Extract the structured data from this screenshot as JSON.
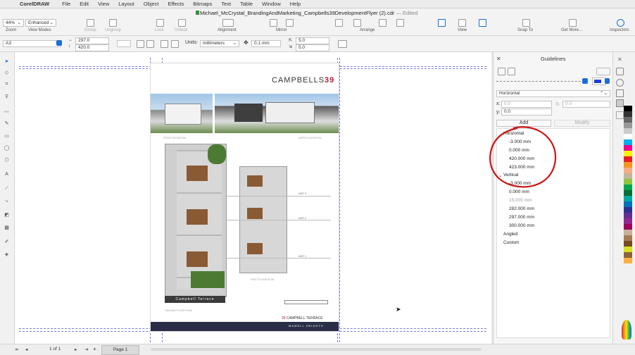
{
  "menubar": {
    "app": "CorelDRAW",
    "items": [
      "File",
      "Edit",
      "View",
      "Layout",
      "Object",
      "Effects",
      "Bitmaps",
      "Text",
      "Table",
      "Window",
      "Help"
    ]
  },
  "toolbar": {
    "title": "Michael_McCrystal_BrandingAndMarketing_Campbells39DevelopmentFlyer (2).cdr",
    "edited": "— Edited",
    "zoom_value": "44%",
    "view_mode_value": "Enhanced",
    "labels": {
      "zoom": "Zoom",
      "view_modes": "View Modes",
      "group": "Group",
      "ungroup": "Ungroup",
      "lock": "Lock",
      "unlock": "Unlock",
      "alignment": "Alignment",
      "mirror": "Mirror",
      "arrange": "Arrange",
      "view": "View",
      "snap_to": "Snap To",
      "get_more": "Get More...",
      "inspectors": "Inspectors"
    }
  },
  "propbar": {
    "page_size": "A3",
    "width": "297.0",
    "height": "420.0",
    "units_label": "Units:",
    "units_value": "millimeters",
    "nudge": "0.1 mm",
    "dup_x": "5.0",
    "dup_y": "5.0"
  },
  "flyer": {
    "brand": "CAMPBELLS",
    "brand_number": "39",
    "front_elevation": "FRONT ELEVATION",
    "north_elevation": "NORTH ELEVATION",
    "unit3": "UNIT 3",
    "unit2": "UNIT 2",
    "unit1": "UNIT 1",
    "first_floor": "FIRST FLOOR PLAN",
    "ground_floor": "GROUND FLOOR PLAN",
    "street_name": "Campbell Terrace",
    "footer_brand_num": "39",
    "footer_brand": "CAMPBELL TERRACE",
    "footer_sub": "MAWELL HEIGHTS"
  },
  "bottombar": {
    "page_count": "1 of 1",
    "page_tab": "Page 1"
  },
  "docker": {
    "title": "Guidelines",
    "type_value": "Horizontal",
    "x_label": "x:",
    "x_value": "0.0",
    "y_label": "y:",
    "y_value": "0.0",
    "angle_value": "0.0",
    "add": "Add",
    "modify": "Modify",
    "groups": [
      {
        "name": "Horizontal",
        "items": [
          "-3.000 mm",
          "0.000 mm",
          "420.000 mm",
          "423.000 mm"
        ]
      },
      {
        "name": "Vertical",
        "items": [
          "-3.000 mm",
          "0.000 mm",
          "15.000 mm",
          "282.000 mm",
          "297.000 mm",
          "300.000 mm"
        ]
      }
    ],
    "angled": "Angled",
    "custom": "Custom"
  },
  "colors": {
    "accent": "#1a6fd6",
    "annotation": "#cc1515",
    "brand_red": "#b8183a",
    "navy_bar": "#2a2e48"
  }
}
